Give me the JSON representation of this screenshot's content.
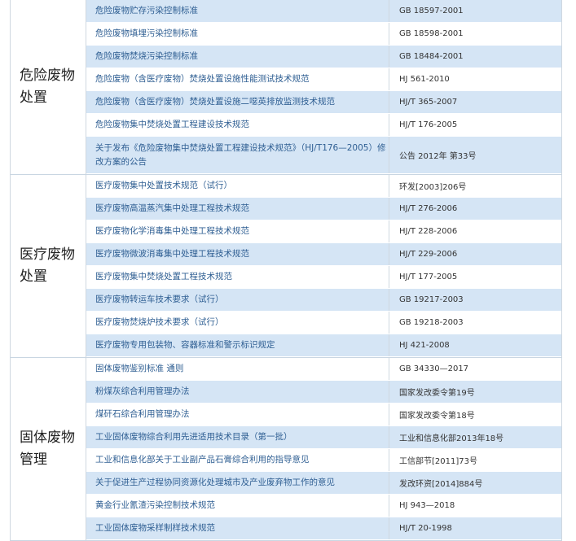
{
  "sections": [
    {
      "title": "危险废物处置",
      "rows": [
        {
          "name": "危险废物贮存污染控制标准",
          "code": "GB 18597-2001"
        },
        {
          "name": "危险废物填埋污染控制标准",
          "code": "GB 18598-2001"
        },
        {
          "name": "危险废物焚烧污染控制标准",
          "code": "GB 18484-2001"
        },
        {
          "name": "危险废物（含医疗废物）焚烧处置设施性能测试技术规范",
          "code": "HJ 561-2010"
        },
        {
          "name": "危险废物（含医疗废物）焚烧处置设施二噁英排放监测技术规范",
          "code": "HJ/T 365-2007"
        },
        {
          "name": "危险废物集中焚烧处置工程建设技术规范",
          "code": "HJ/T 176-2005"
        },
        {
          "name": "关于发布《危险废物集中焚烧处置工程建设技术规范》（HJ/T176—2005）修改方案的公告",
          "code": "公告 2012年 第33号"
        }
      ]
    },
    {
      "title": "医疗废物处置",
      "rows": [
        {
          "name": "医疗废物集中处置技术规范（试行）",
          "code": "环发[2003]206号"
        },
        {
          "name": "医疗废物高温蒸汽集中处理工程技术规范",
          "code": "HJ/T 276-2006"
        },
        {
          "name": "医疗废物化学消毒集中处理工程技术规范",
          "code": "HJ/T 228-2006"
        },
        {
          "name": "医疗废物微波消毒集中处理工程技术规范",
          "code": "HJ/T 229-2006"
        },
        {
          "name": "医疗废物集中焚烧处置工程技术规范",
          "code": "HJ/T 177-2005"
        },
        {
          "name": "医疗废物转运车技术要求（试行）",
          "code": "GB 19217-2003"
        },
        {
          "name": "医疗废物焚烧炉技术要求（试行）",
          "code": "GB 19218-2003"
        },
        {
          "name": "医疗废物专用包装物、容器标准和警示标识规定",
          "code": "HJ 421-2008"
        }
      ]
    },
    {
      "title": "固体废物管理",
      "rows": [
        {
          "name": "固体废物鉴别标准 通则",
          "code": "GB 34330—2017"
        },
        {
          "name": "粉煤灰综合利用管理办法",
          "code": "国家发改委令第19号"
        },
        {
          "name": "煤矸石综合利用管理办法",
          "code": "国家发改委令第18号"
        },
        {
          "name": "工业固体废物综合利用先进适用技术目录（第一批）",
          "code": "工业和信息化部2013年18号"
        },
        {
          "name": "工业和信息化部关于工业副产品石膏综合利用的指导意见",
          "code": "工信部节[2011]73号"
        },
        {
          "name": "关于促进生产过程协同资源化处理城市及产业废弃物工作的意见",
          "code": "发改环资[2014]884号"
        },
        {
          "name": "黄金行业氰渣污染控制技术规范",
          "code": "HJ 943—2018"
        },
        {
          "name": "工业固体废物采样制样技术规范",
          "code": "HJ/T 20-1998"
        }
      ]
    }
  ]
}
